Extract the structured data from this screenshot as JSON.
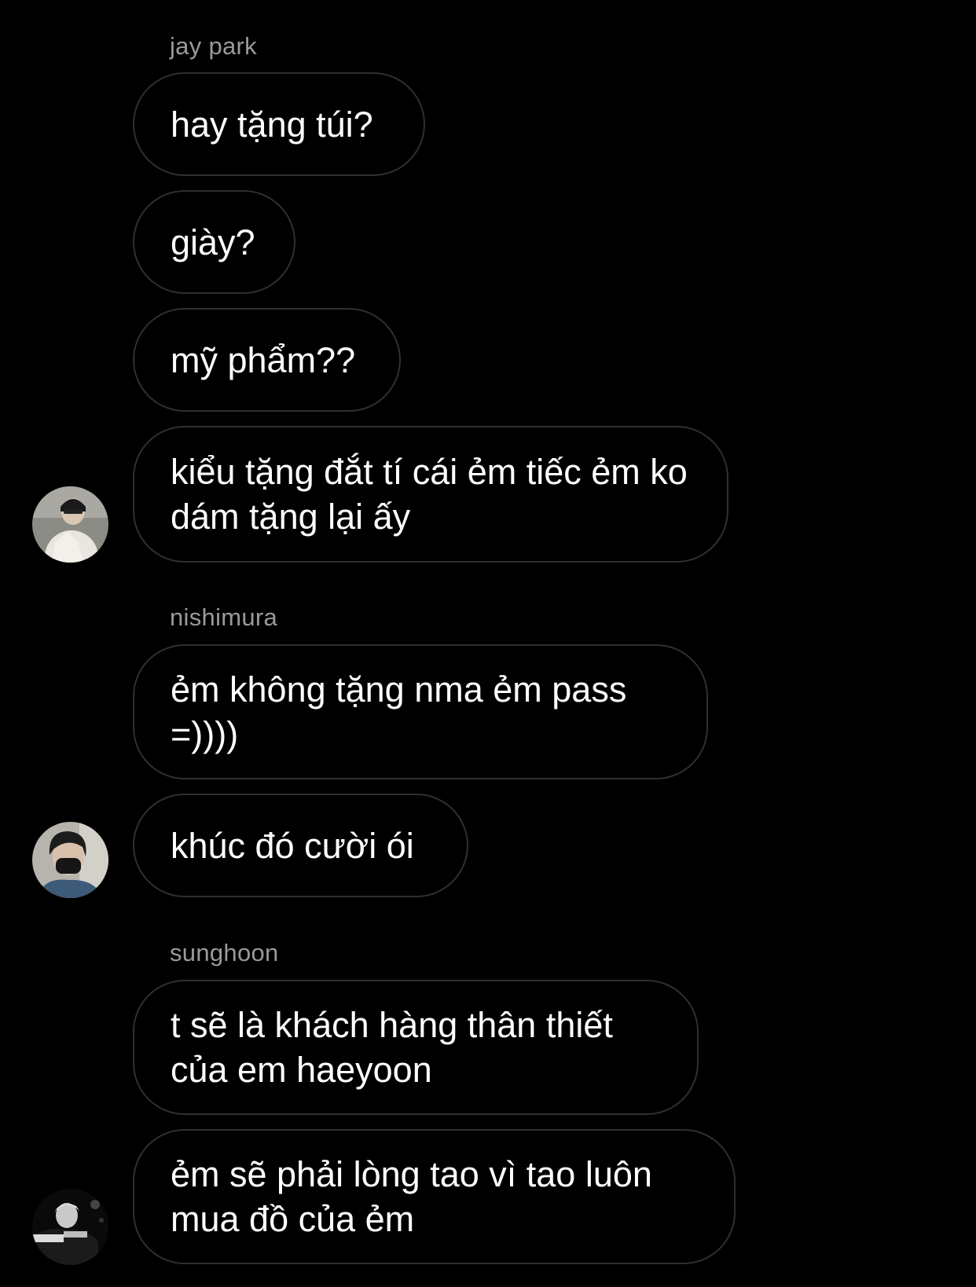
{
  "thread": {
    "groups": [
      {
        "sender": "jay park",
        "messages": [
          "hay tặng túi?",
          "giày?",
          "mỹ phẩm??",
          "kiểu tặng đắt tí cái ẻm tiếc ẻm ko dám tặng lại ấy"
        ],
        "avatar_icon": "avatar-jay-park-icon"
      },
      {
        "sender": "nishimura",
        "messages": [
          "ẻm không tặng nma ẻm pass =))))",
          "khúc đó cười ói"
        ],
        "avatar_icon": "avatar-nishimura-icon"
      },
      {
        "sender": "sunghoon",
        "messages": [
          "t sẽ là khách hàng thân thiết của em haeyoon",
          "ẻm sẽ phải lòng tao vì tao luôn mua đồ của ẻm"
        ],
        "avatar_icon": "avatar-sunghoon-icon"
      }
    ]
  },
  "colors": {
    "background": "#000000",
    "bubble_border": "#2f2f2f",
    "sender_name": "#9a9a9a",
    "message_text": "#ffffff"
  }
}
